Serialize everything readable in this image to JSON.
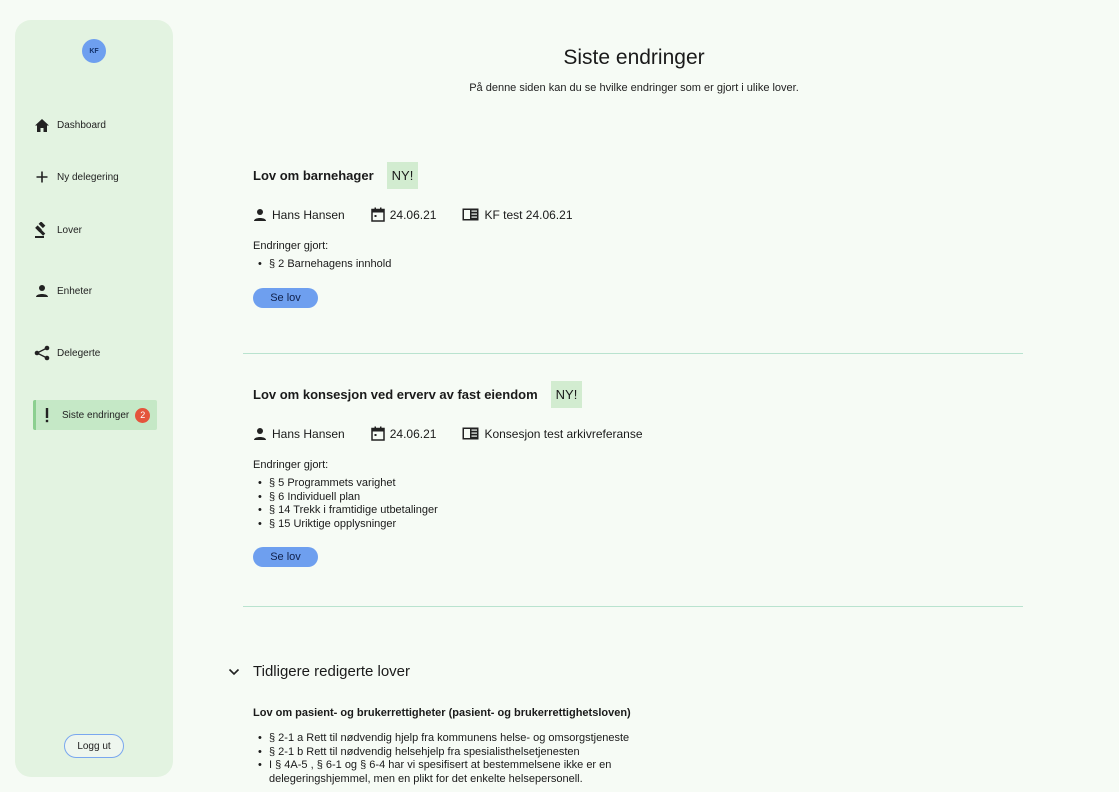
{
  "user": {
    "initials": "KF"
  },
  "sidebar": {
    "items": [
      {
        "label": "Dashboard",
        "icon": "home-icon"
      },
      {
        "label": "Ny delegering",
        "icon": "plus-icon"
      },
      {
        "label": "Lover",
        "icon": "gavel-icon"
      },
      {
        "label": "Enheter",
        "icon": "person-icon"
      },
      {
        "label": "Delegerte",
        "icon": "share-icon"
      },
      {
        "label": "Siste endringer",
        "icon": "exclamation-icon",
        "badge": "2",
        "active": true
      }
    ],
    "logout_label": "Logg ut"
  },
  "page": {
    "title": "Siste endringer",
    "subtitle": "På denne siden kan du se hvilke endringer som er gjort i ulike lover."
  },
  "laws": [
    {
      "name": "Lov om barnehager",
      "tag": "NY!",
      "author": "Hans Hansen",
      "date": "24.06.21",
      "reference": "KF test 24.06.21",
      "changes_label": "Endringer gjort:",
      "changes": [
        "§ 2 Barnehagens innhold"
      ],
      "button": "Se lov"
    },
    {
      "name": "Lov om konsesjon ved erverv av fast eiendom",
      "tag": "NY!",
      "author": "Hans Hansen",
      "date": "24.06.21",
      "reference": "Konsesjon test arkivreferanse",
      "changes_label": "Endringer gjort:",
      "changes": [
        "§ 5 Programmets varighet",
        "§ 6 Individuell plan",
        "§ 14 Trekk i framtidige utbetalinger",
        "§ 15 Uriktige opplysninger"
      ],
      "button": "Se lov"
    }
  ],
  "previous": {
    "heading": "Tidligere redigerte lover",
    "law_name": "Lov om pasient- og brukerrettigheter (pasient- og brukerrettighetsloven)",
    "changes": [
      "§ 2-1 a Rett til nødvendig hjelp fra kommunens helse- og omsorgstjeneste",
      "§ 2-1 b Rett til nødvendig helsehjelp fra spesialisthelsetjenesten",
      "I § 4A-5 , § 6-1 og § 6-4 har vi spesifisert at bestemmelsene ikke er en",
      "delegeringshjemmel, men en plikt for det enkelte helsepersonell."
    ]
  },
  "colors": {
    "accent_blue": "#6e9fef",
    "sidebar_bg": "#e3f3e1",
    "active_bg": "#c5e8c6",
    "badge_red": "#e4553c",
    "tag_bg": "#d2ecd0"
  }
}
